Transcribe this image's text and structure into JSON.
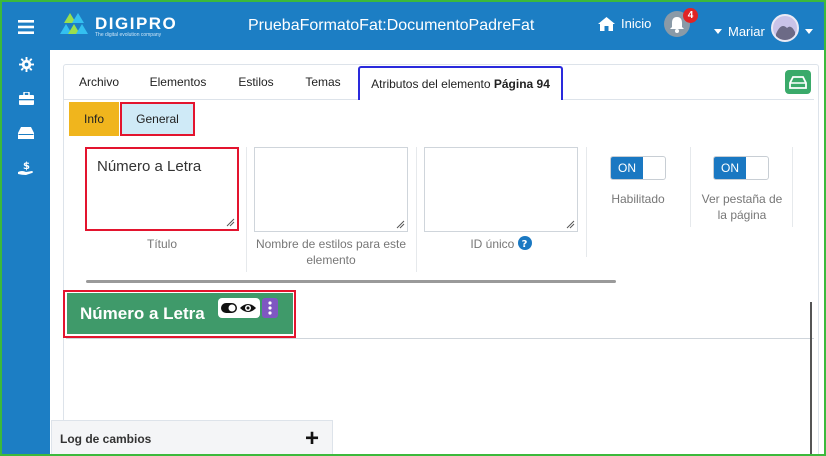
{
  "colors": {
    "brand_blue": "#1c7ec4",
    "accent_green": "#3f9a6a",
    "active_tab_border": "#2a2adc",
    "highlight_red": "#e3142e",
    "info_yellow": "#f0b51d",
    "toggle_blue": "#1a78c2"
  },
  "sidebar": {
    "icons": [
      "menu-icon",
      "gear-icon",
      "toolbox-icon",
      "hard-drive-icon",
      "dollar-hand-icon"
    ]
  },
  "header": {
    "logo_text": "DIGIPRO",
    "logo_tagline": "The digital evolution company",
    "document_title": "PruebaFormatoFat:DocumentoPadreFat",
    "home_label": "Inicio",
    "notification_count": "4",
    "user_name": "Mariar"
  },
  "tabs": {
    "archivo": "Archivo",
    "elementos": "Elementos",
    "estilos": "Estilos",
    "temas": "Temas",
    "atributos_prefix": "Atributos del elemento ",
    "atributos_bold": "Página 94"
  },
  "subtabs": {
    "info": "Info",
    "general": "General"
  },
  "fields": {
    "titulo_value": "Número a Letra",
    "titulo_label": "Título",
    "estilos_label": "Nombre de estilos para este elemento",
    "id_label": "ID único",
    "habilitado_toggle": "ON",
    "habilitado_label": "Habilitado",
    "pestana_toggle": "ON",
    "pestana_label": "Ver pestaña de la página"
  },
  "preview": {
    "title": "Número a Letra"
  },
  "changelog": {
    "label": "Log de cambios",
    "add": "+"
  }
}
